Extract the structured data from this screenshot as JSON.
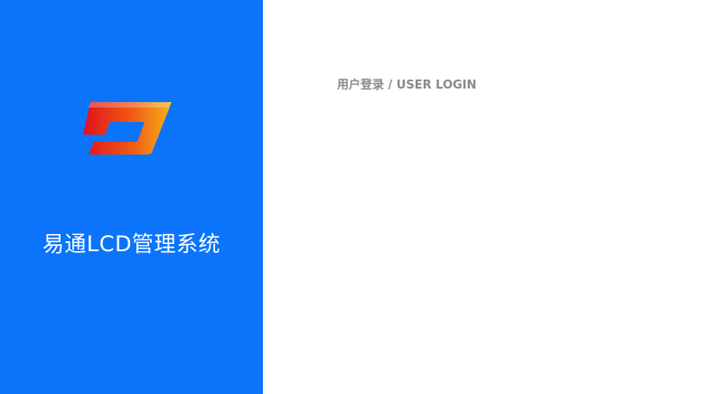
{
  "brand": {
    "logo_icon": "app-logo-icon",
    "title": "易通LCD管理系统",
    "panel_color": "#0b74fb",
    "logo_gradient": [
      "#e0101e",
      "#f7b21a"
    ]
  },
  "login": {
    "heading": "用户登录 / USER LOGIN"
  }
}
